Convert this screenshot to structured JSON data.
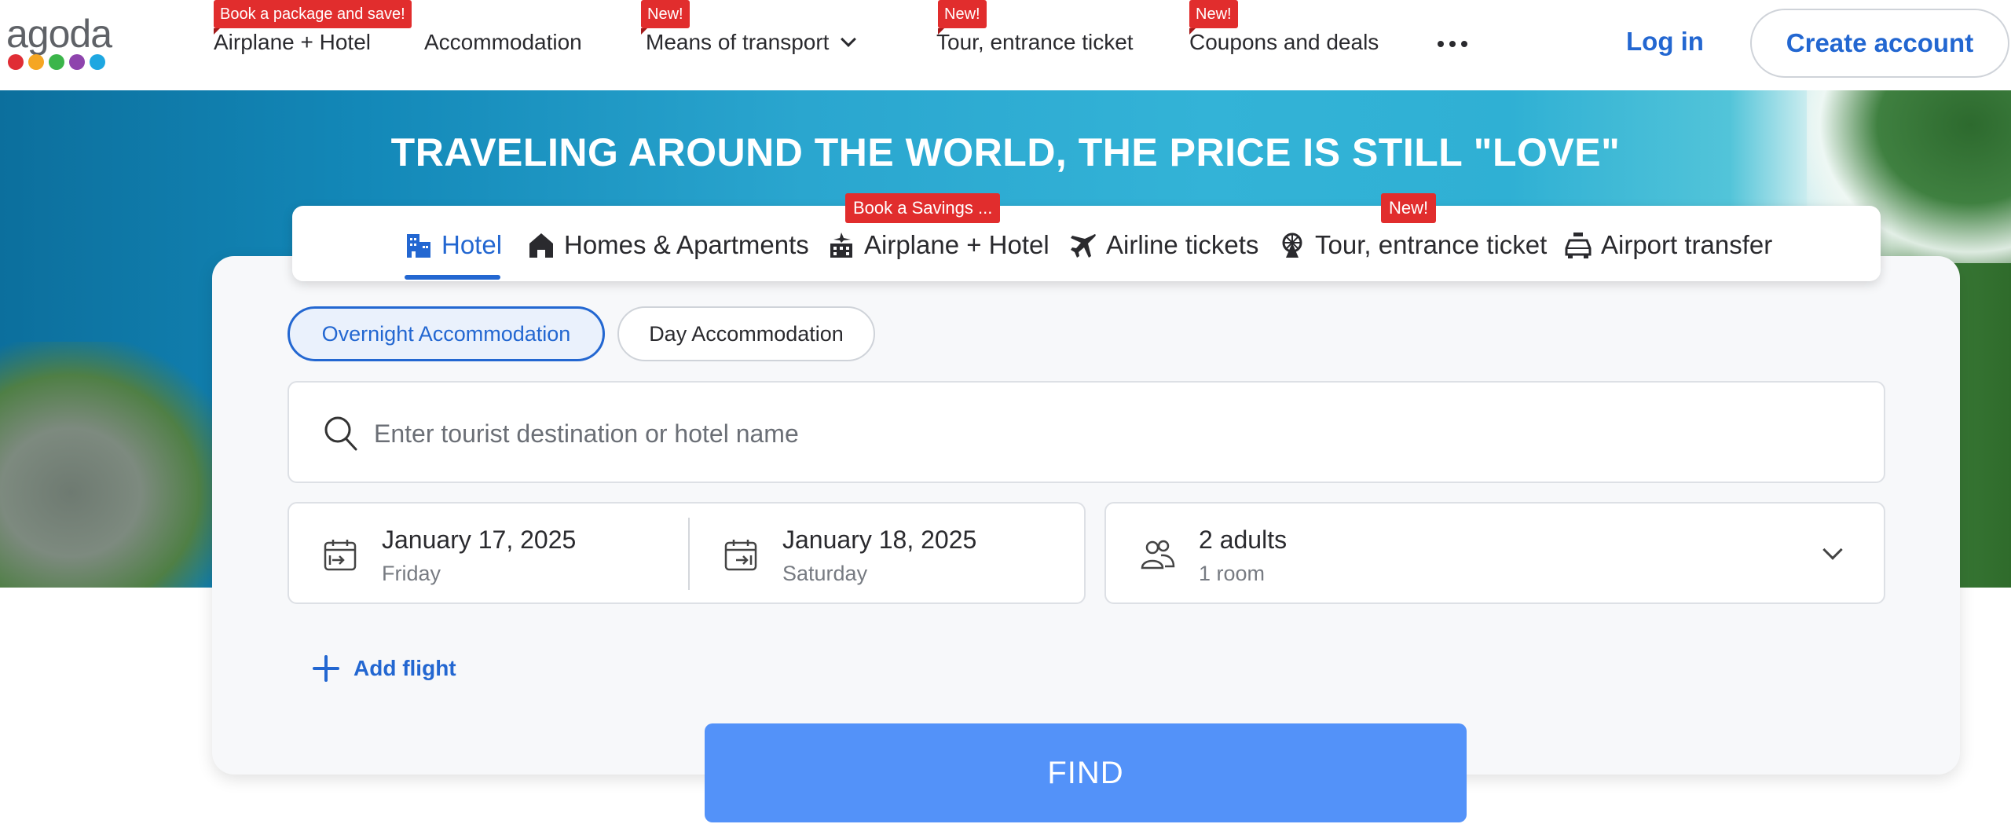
{
  "brand": {
    "logo_text": "agoda",
    "logo_dot_colors": [
      "#e02d35",
      "#f5a623",
      "#3bb54a",
      "#8e44ad",
      "#1ea7e1"
    ]
  },
  "header": {
    "nav": [
      {
        "label": "Airplane + Hotel",
        "badge": "Book a package and save!"
      },
      {
        "label": "Accommodation",
        "badge": ""
      },
      {
        "label": "Means of transport",
        "badge": "New!",
        "has_dropdown": true
      },
      {
        "label": "Tour, entrance ticket",
        "badge": "New!"
      },
      {
        "label": "Coupons and deals",
        "badge": "New!"
      }
    ],
    "more_icon": "more-horizontal-icon",
    "login_label": "Log in",
    "create_account_label": "Create account"
  },
  "hero": {
    "title": "TRAVELING AROUND THE WORLD, THE PRICE IS STILL \"LOVE\""
  },
  "tabs": [
    {
      "label": "Hotel",
      "icon": "hotel-icon",
      "active": true,
      "badge": ""
    },
    {
      "label": "Homes & Apartments",
      "icon": "home-icon",
      "active": false,
      "badge": ""
    },
    {
      "label": "Airplane + Hotel",
      "icon": "flight-hotel-icon",
      "active": false,
      "badge": "Book a Savings ..."
    },
    {
      "label": "Airline tickets",
      "icon": "airplane-icon",
      "active": false,
      "badge": ""
    },
    {
      "label": "Tour, entrance ticket",
      "icon": "ferris-wheel-icon",
      "active": false,
      "badge": "New!"
    },
    {
      "label": "Airport transfer",
      "icon": "car-icon",
      "active": false,
      "badge": ""
    }
  ],
  "search_card": {
    "accommodation_types": [
      {
        "label": "Overnight Accommodation",
        "selected": true
      },
      {
        "label": "Day Accommodation",
        "selected": false
      }
    ],
    "destination": {
      "value": "",
      "placeholder": "Enter tourist destination or hotel name"
    },
    "check_in": {
      "date": "January 17, 2025",
      "day": "Friday"
    },
    "check_out": {
      "date": "January 18, 2025",
      "day": "Saturday"
    },
    "guests": {
      "adults": "2 adults",
      "rooms": "1 room"
    },
    "add_flight_label": "Add flight",
    "find_label": "FIND"
  },
  "colors": {
    "accent": "#2367d1",
    "find_button": "#5392f9",
    "badge": "#e12d2d"
  }
}
